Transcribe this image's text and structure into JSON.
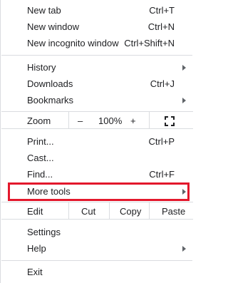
{
  "menu": {
    "new_tab": {
      "label": "New tab",
      "shortcut": "Ctrl+T"
    },
    "new_window": {
      "label": "New window",
      "shortcut": "Ctrl+N"
    },
    "new_incognito": {
      "label": "New incognito window",
      "shortcut": "Ctrl+Shift+N"
    },
    "history": {
      "label": "History"
    },
    "downloads": {
      "label": "Downloads",
      "shortcut": "Ctrl+J"
    },
    "bookmarks": {
      "label": "Bookmarks"
    },
    "zoom": {
      "label": "Zoom",
      "minus": "–",
      "value": "100%",
      "plus": "+"
    },
    "print": {
      "label": "Print...",
      "shortcut": "Ctrl+P"
    },
    "cast": {
      "label": "Cast..."
    },
    "find": {
      "label": "Find...",
      "shortcut": "Ctrl+F"
    },
    "more_tools": {
      "label": "More tools"
    },
    "edit": {
      "label": "Edit",
      "cut": "Cut",
      "copy": "Copy",
      "paste": "Paste"
    },
    "settings": {
      "label": "Settings"
    },
    "help": {
      "label": "Help"
    },
    "exit": {
      "label": "Exit"
    }
  },
  "colors": {
    "highlight": "#e3182c",
    "separator": "#dadce0",
    "text": "#202124"
  },
  "icons": {
    "submenu": "chevron-right-icon",
    "fullscreen": "fullscreen-icon"
  }
}
